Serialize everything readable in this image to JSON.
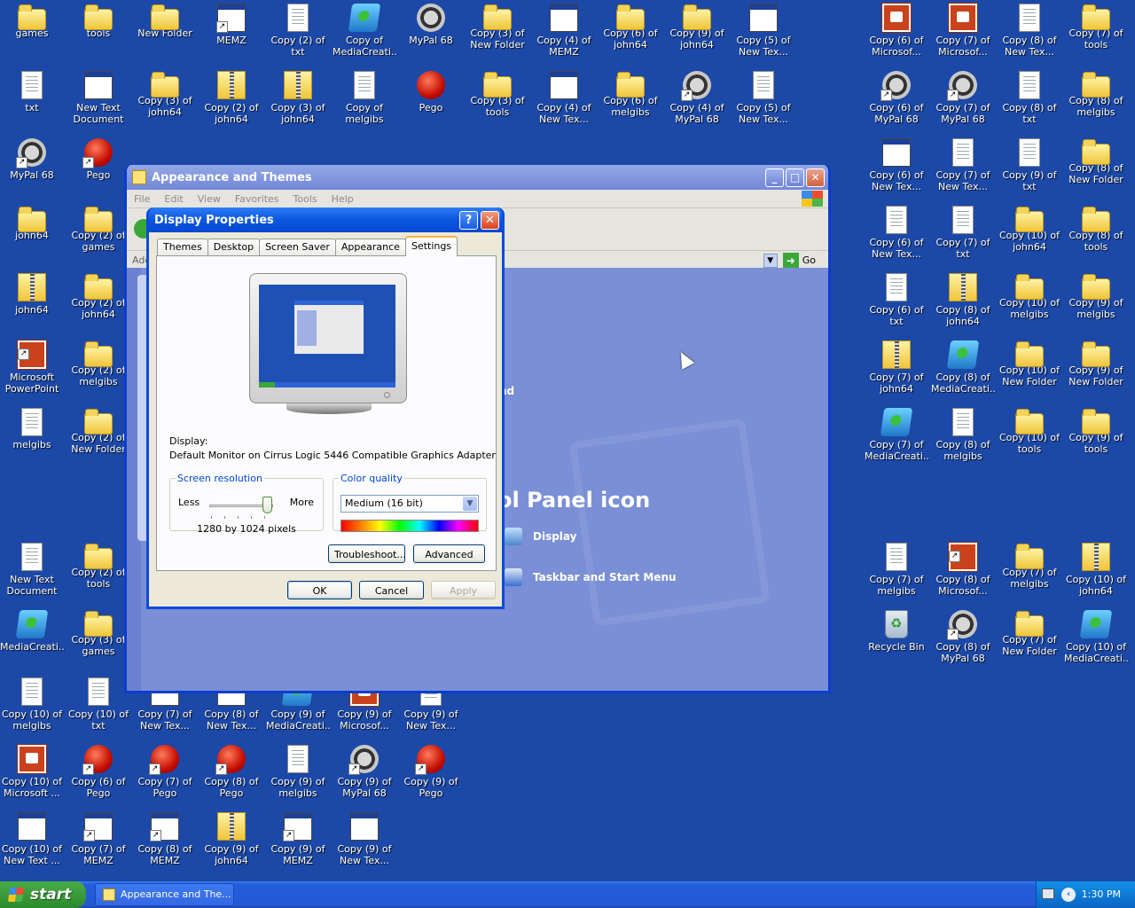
{
  "desktop": {
    "icons": [
      {
        "label": "games",
        "type": "folder"
      },
      {
        "label": "tools",
        "type": "folder"
      },
      {
        "label": "New Folder",
        "type": "folder"
      },
      {
        "label": "MEMZ",
        "type": "win",
        "shortcut": true
      },
      {
        "label": "Copy (2) of txt",
        "type": "doc"
      },
      {
        "label": "Copy of MediaCreati...",
        "type": "media"
      },
      {
        "label": "MyPal 68",
        "type": "raccoon"
      },
      {
        "label": "Copy (3) of New Folder",
        "type": "folder"
      },
      {
        "label": "Copy (4) of MEMZ",
        "type": "win"
      },
      {
        "label": "Copy (6) of john64",
        "type": "folder"
      },
      {
        "label": "Copy (9) of john64",
        "type": "folder"
      },
      {
        "label": "Copy (5) of New Tex...",
        "type": "win"
      },
      {
        "label": "Copy (6) of Microsof...",
        "type": "ppt"
      },
      {
        "label": "Copy (7) of Microsof...",
        "type": "ppt"
      },
      {
        "label": "Copy (8) of New Tex...",
        "type": "doc"
      },
      {
        "label": "Copy (7) of tools",
        "type": "folder"
      },
      {
        "label": "txt",
        "type": "doc"
      },
      {
        "label": "New Text Document",
        "type": "win"
      },
      {
        "label": "Copy (3) of john64",
        "type": "folder"
      },
      {
        "label": "Copy (2) of john64",
        "type": "zip"
      },
      {
        "label": "Copy (3) of john64",
        "type": "zip"
      },
      {
        "label": "Copy of melgibs",
        "type": "doc"
      },
      {
        "label": "Pego",
        "type": "red"
      },
      {
        "label": "Copy (3) of tools",
        "type": "folder"
      },
      {
        "label": "Copy (4) of New Tex...",
        "type": "win"
      },
      {
        "label": "Copy (6) of melgibs",
        "type": "folder"
      },
      {
        "label": "Copy (4) of MyPal 68",
        "type": "raccoon",
        "shortcut": true
      },
      {
        "label": "Copy (5) of New Tex...",
        "type": "doc"
      },
      {
        "label": "Copy (6) of MyPal 68",
        "type": "raccoon",
        "shortcut": true
      },
      {
        "label": "Copy (7) of MyPal 68",
        "type": "raccoon",
        "shortcut": true
      },
      {
        "label": "Copy (8) of txt",
        "type": "doc"
      },
      {
        "label": "Copy (8) of melgibs",
        "type": "folder"
      },
      {
        "label": "MyPal 68",
        "type": "raccoon",
        "shortcut": true
      },
      {
        "label": "Pego",
        "type": "red",
        "shortcut": true
      },
      {
        "label": "Copy (6) of New Tex...",
        "type": "win"
      },
      {
        "label": "Copy (7) of New Tex...",
        "type": "doc"
      },
      {
        "label": "Copy (9) of txt",
        "type": "doc"
      },
      {
        "label": "Copy (8) of New Folder",
        "type": "folder"
      },
      {
        "label": "john64",
        "type": "folder"
      },
      {
        "label": "Copy (2) of games",
        "type": "folder"
      },
      {
        "label": "Copy (6) of New Tex...",
        "type": "doc"
      },
      {
        "label": "Copy (7) of txt",
        "type": "doc"
      },
      {
        "label": "Copy (10) of john64",
        "type": "folder"
      },
      {
        "label": "Copy (8) of tools",
        "type": "folder"
      },
      {
        "label": "john64",
        "type": "zip"
      },
      {
        "label": "Copy (2) of john64",
        "type": "folder"
      },
      {
        "label": "Copy (6) of txt",
        "type": "doc"
      },
      {
        "label": "Copy (8) of john64",
        "type": "zip"
      },
      {
        "label": "Copy (10) of melgibs",
        "type": "folder"
      },
      {
        "label": "Copy (9) of melgibs",
        "type": "folder"
      },
      {
        "label": "Microsoft PowerPoint",
        "type": "ppt",
        "shortcut": true
      },
      {
        "label": "Copy (2) of melgibs",
        "type": "folder"
      },
      {
        "label": "Copy (7) of john64",
        "type": "zip"
      },
      {
        "label": "Copy (8) of MediaCreati...",
        "type": "media"
      },
      {
        "label": "Copy (10) of New Folder",
        "type": "folder"
      },
      {
        "label": "Copy (9) of New Folder",
        "type": "folder"
      },
      {
        "label": "melgibs",
        "type": "doc"
      },
      {
        "label": "Copy (2) of New Folder",
        "type": "folder"
      },
      {
        "label": "Copy (7) of MediaCreati...",
        "type": "media"
      },
      {
        "label": "Copy (8) of melgibs",
        "type": "doc"
      },
      {
        "label": "Copy (10) of tools",
        "type": "folder"
      },
      {
        "label": "Copy (9) of tools",
        "type": "folder"
      },
      {
        "label": "New Text Document",
        "type": "doc"
      },
      {
        "label": "Copy (2) of tools",
        "type": "folder"
      },
      {
        "label": "Copy (7) of melgibs",
        "type": "doc"
      },
      {
        "label": "Copy (8) of Microsof...",
        "type": "ppt",
        "shortcut": true
      },
      {
        "label": "Copy (7) of melgibs",
        "type": "folder"
      },
      {
        "label": "Copy (10) of john64",
        "type": "zip"
      },
      {
        "label": "MediaCreati...",
        "type": "media"
      },
      {
        "label": "Copy (3) of games",
        "type": "folder"
      },
      {
        "label": "Recycle Bin",
        "type": "bin"
      },
      {
        "label": "Copy (8) of MyPal 68",
        "type": "raccoon",
        "shortcut": true
      },
      {
        "label": "Copy (7) of New Folder",
        "type": "folder"
      },
      {
        "label": "Copy (10) of MediaCreati...",
        "type": "media"
      },
      {
        "label": "Copy (10) of melgibs",
        "type": "doc"
      },
      {
        "label": "Copy (10) of txt",
        "type": "doc"
      },
      {
        "label": "Copy (7) of New Tex...",
        "type": "win"
      },
      {
        "label": "Copy (8) of New Tex...",
        "type": "win"
      },
      {
        "label": "Copy (9) of MediaCreati...",
        "type": "media"
      },
      {
        "label": "Copy (9) of Microsof...",
        "type": "ppt"
      },
      {
        "label": "Copy (9) of New Tex...",
        "type": "doc"
      },
      {
        "label": "Copy (10) of Microsoft ...",
        "type": "ppt"
      },
      {
        "label": "Copy (6) of Pego",
        "type": "red",
        "shortcut": true
      },
      {
        "label": "Copy (7) of Pego",
        "type": "red",
        "shortcut": true
      },
      {
        "label": "Copy (8) of Pego",
        "type": "red",
        "shortcut": true
      },
      {
        "label": "Copy (9) of melgibs",
        "type": "doc"
      },
      {
        "label": "Copy (9) of MyPal 68",
        "type": "raccoon",
        "shortcut": true
      },
      {
        "label": "Copy (9) of Pego",
        "type": "red",
        "shortcut": true
      },
      {
        "label": "Copy (10) of New Text ...",
        "type": "win"
      },
      {
        "label": "Copy (7) of MEMZ",
        "type": "win",
        "shortcut": true
      },
      {
        "label": "Copy (8) of MEMZ",
        "type": "win",
        "shortcut": true
      },
      {
        "label": "Copy (9) of john64",
        "type": "zip"
      },
      {
        "label": "Copy (9) of MEMZ",
        "type": "win",
        "shortcut": true
      },
      {
        "label": "Copy (9) of New Tex...",
        "type": "win"
      }
    ]
  },
  "explorer": {
    "title": "Appearance and Themes",
    "menu": [
      "File",
      "Edit",
      "View",
      "Favorites",
      "Tools",
      "Help"
    ],
    "address_label": "Add",
    "go_label": "Go",
    "heading_fragment": "nd",
    "heading": "ol Panel icon",
    "links": [
      {
        "label": "Display",
        "icon": "display-icon"
      },
      {
        "label": "Taskbar and Start Menu",
        "icon": "taskbar-icon"
      }
    ]
  },
  "dialog": {
    "title": "Display Properties",
    "help_label": "?",
    "close_label": "✕",
    "tabs": [
      "Themes",
      "Desktop",
      "Screen Saver",
      "Appearance",
      "Settings"
    ],
    "active_tab": "Settings",
    "display_label": "Display:",
    "display_value": "Default Monitor on Cirrus Logic 5446 Compatible Graphics Adapter",
    "resolution": {
      "legend": "Screen resolution",
      "less": "Less",
      "more": "More",
      "value_text": "1280 by 1024 pixels"
    },
    "color_quality": {
      "legend": "Color quality",
      "selected": "Medium (16 bit)"
    },
    "buttons": {
      "troubleshoot": "Troubleshoot...",
      "advanced": "Advanced",
      "ok": "OK",
      "cancel": "Cancel",
      "apply": "Apply"
    }
  },
  "taskbar": {
    "start_label": "start",
    "task_label": "Appearance and The...",
    "clock": "1:30 PM"
  },
  "colors": {
    "desktop": "#1c49a7",
    "xp_titlebar": "#0a56e0",
    "start_green": "#3c9a3c"
  }
}
